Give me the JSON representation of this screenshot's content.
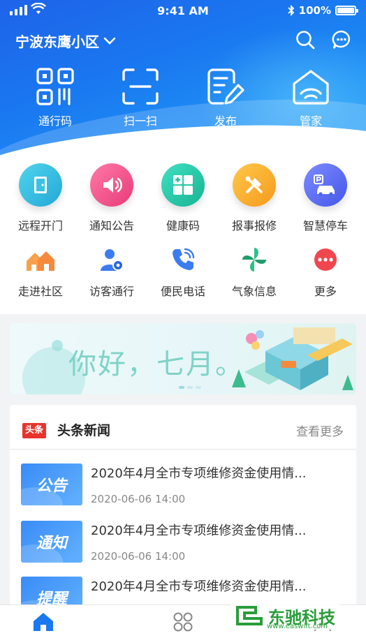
{
  "status": {
    "time": "9:41 AM",
    "battery": "100%"
  },
  "header": {
    "community": "宁波东鹰小区",
    "quick_actions": [
      {
        "label": "通行码",
        "icon": "qr-code-icon"
      },
      {
        "label": "扫一扫",
        "icon": "scan-icon"
      },
      {
        "label": "发布",
        "icon": "publish-edit-icon"
      },
      {
        "label": "管家",
        "icon": "home-steward-icon"
      }
    ]
  },
  "services": {
    "row1": [
      {
        "label": "远程开门",
        "icon": "door-icon",
        "color": "#29b6d8"
      },
      {
        "label": "通知公告",
        "icon": "speaker-icon",
        "color": "#f0508a"
      },
      {
        "label": "健康码",
        "icon": "health-code-icon",
        "color": "#25c3a2"
      },
      {
        "label": "报事报修",
        "icon": "repair-tools-icon",
        "color": "#f7a52a"
      },
      {
        "label": "智慧停车",
        "icon": "parking-car-icon",
        "color": "#5a6cf2"
      }
    ],
    "row2": [
      {
        "label": "走进社区",
        "icon": "community-houses-icon",
        "color": "#f58a3c"
      },
      {
        "label": "访客通行",
        "icon": "visitor-icon",
        "color": "#3b7cf0"
      },
      {
        "label": "便民电话",
        "icon": "phone-icon",
        "color": "#3b7cf0"
      },
      {
        "label": "气象信息",
        "icon": "pinwheel-icon",
        "color": "#25b37a"
      },
      {
        "label": "更多",
        "icon": "more-icon",
        "color": "#f0474f"
      }
    ]
  },
  "banner": {
    "greeting": "你好，七月。"
  },
  "news": {
    "tag": "头条",
    "title": "头条新闻",
    "more": "查看更多",
    "items": [
      {
        "thumb": "公告",
        "title": "2020年4月全市专项维修资金使用情...",
        "time": "2020-06-06 14:00"
      },
      {
        "thumb": "通知",
        "title": "2020年4月全市专项维修资金使用情...",
        "time": "2020-06-06 14:00"
      },
      {
        "thumb": "提醒",
        "title": "2020年4月全市专项维修资金使用情...",
        "time": ""
      }
    ]
  },
  "watermark": {
    "name": "东驰科技",
    "url": "www.easwift.com"
  },
  "colors": {
    "brand_blue": "#1a78f0",
    "tab_active": "#1a78f0"
  }
}
